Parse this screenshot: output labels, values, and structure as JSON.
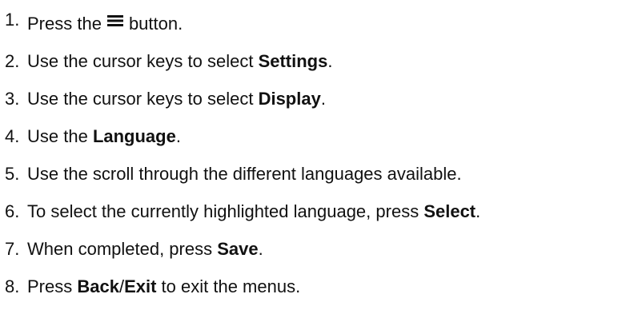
{
  "steps": [
    {
      "num": "1.",
      "before": "Press the",
      "icon": "menu-icon",
      "after": "button."
    },
    {
      "num": "2.",
      "before": "Use the cursor keys to select ",
      "bold": "Settings",
      "after": "."
    },
    {
      "num": "3.",
      "before": "Use the cursor keys to select ",
      "bold": "Display",
      "after": "."
    },
    {
      "num": "4.",
      "before": "Use the ",
      "bold": "Language",
      "after": "."
    },
    {
      "num": "5.",
      "before": "Use the scroll through the different languages available."
    },
    {
      "num": "6.",
      "before": "To select the currently highlighted language, press ",
      "bold": "Select",
      "after": "."
    },
    {
      "num": "7.",
      "before": "When completed, press ",
      "bold": "Save",
      "after": "."
    },
    {
      "num": "8.",
      "before": "Press ",
      "bold": "Back",
      "slash": "/",
      "bold2": "Exit",
      "after": " to exit the menus."
    }
  ]
}
